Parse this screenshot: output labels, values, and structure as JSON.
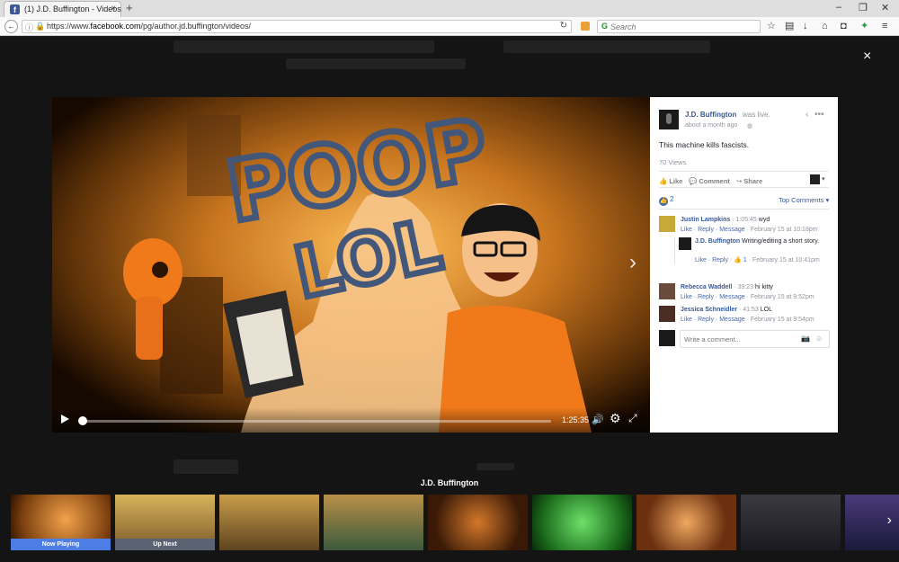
{
  "browser": {
    "tab_title": "(1) J.D. Buffington - Videos",
    "tab_close": "×",
    "new_tab": "+",
    "url_prefix": "https://www.",
    "url_domain": "facebook.com",
    "url_path": "/pg/author.jd.buffington/videos/",
    "search_placeholder": "Search"
  },
  "modal": {
    "close": "×"
  },
  "video": {
    "overlay_text_1": "POOP",
    "overlay_text_2": "LOL",
    "duration": "1:25:35",
    "progress_fraction": 0.0
  },
  "post": {
    "author": "J.D. Buffington",
    "was_live": "was live.",
    "timestamp": "about a month ago",
    "status": "This machine kills fascists.",
    "views": "70 Views",
    "like": "Like",
    "comment": "Comment",
    "share": "Share",
    "like_count": "2",
    "top_comments": "Top Comments",
    "write_placeholder": "Write a comment..."
  },
  "comments": [
    {
      "author": "Justin Lampkins",
      "timestamp": "1:05:45",
      "text": "wyd",
      "like": "Like",
      "reply": "Reply",
      "message": "Message",
      "date": "February 15 at 10:18pm"
    },
    {
      "author": "J.D. Buffington",
      "text": "Writing/editing a short story.",
      "like": "Like",
      "reply": "Reply",
      "reactions": "1",
      "date": "February 15 at 10:41pm"
    },
    {
      "author": "Rebecca Waddell",
      "timestamp": "39:23",
      "text": "hi kitty",
      "like": "Like",
      "reply": "Reply",
      "message": "Message",
      "date": "February 15 at 9:52pm"
    },
    {
      "author": "Jessica Schneidler",
      "timestamp": "41:53",
      "text": "LOL",
      "like": "Like",
      "reply": "Reply",
      "message": "Message",
      "date": "February 15 at 9:54pm"
    }
  ],
  "strip": {
    "title": "J.D. Buffington",
    "now_playing": "Now Playing",
    "up_next": "Up Next"
  },
  "colors": {
    "facebook_blue": "#365899",
    "now_playing_bg": "#4c7ee6",
    "up_next_bg": "#5b6272"
  }
}
